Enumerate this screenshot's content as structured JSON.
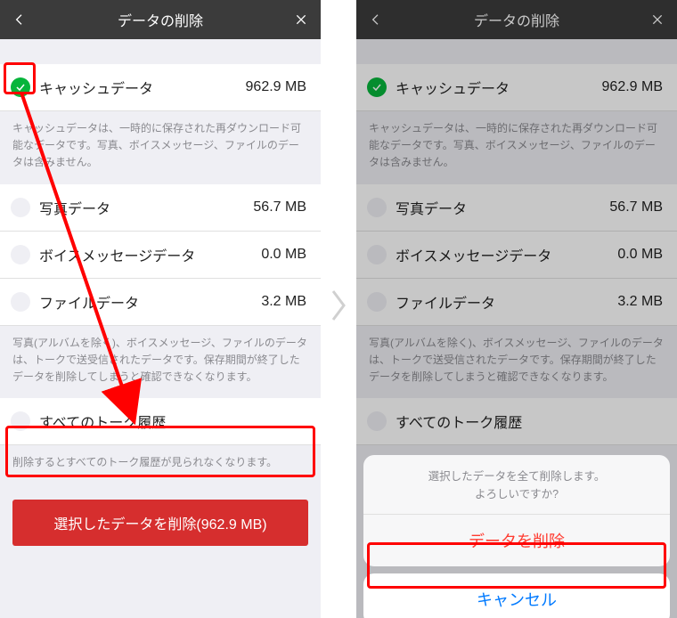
{
  "header": {
    "title": "データの削除"
  },
  "items": {
    "cache": {
      "label": "キャッシュデータ",
      "size": "962.9 MB"
    },
    "photo": {
      "label": "写真データ",
      "size": "56.7 MB"
    },
    "voice": {
      "label": "ボイスメッセージデータ",
      "size": "0.0 MB"
    },
    "file": {
      "label": "ファイルデータ",
      "size": "3.2 MB"
    },
    "history": {
      "label": "すべてのトーク履歴"
    }
  },
  "desc": {
    "cache": "キャッシュデータは、一時的に保存された再ダウンロード可能なデータです。写真、ボイスメッセージ、ファイルのデータは含みません。",
    "media": "写真(アルバムを除く)、ボイスメッセージ、ファイルのデータは、トークで送受信されたデータです。保存期間が終了したデータを削除してしまうと確認できなくなります。",
    "history": "削除するとすべてのトーク履歴が見られなくなります。"
  },
  "deleteButton": "選択したデータを削除(962.9 MB)",
  "sheet": {
    "message1": "選択したデータを全て削除します。",
    "message2": "よろしいですか?",
    "confirm": "データを削除",
    "cancel": "キャンセル"
  }
}
